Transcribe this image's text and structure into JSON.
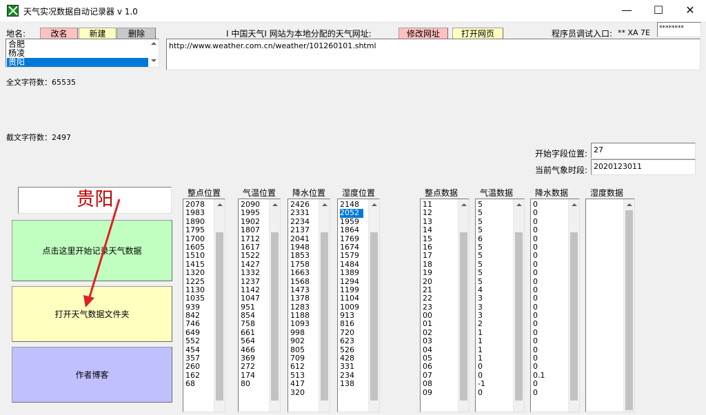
{
  "window": {
    "title": "天气实况数据自动记录器 v 1.0",
    "minimize": "—",
    "maximize": "☐",
    "close": "✕"
  },
  "toolbar": {
    "place_label": "地名:",
    "rename_btn": "改名",
    "new_btn": "新建",
    "delete_btn": "删除",
    "url_caption": "I 中国天气I 网站为本地分配的天气网址:",
    "edit_url_btn": "修改网址",
    "open_page_btn": "打开网页",
    "debug_label": "程序员调试入口:",
    "debug_code": "** XA 7E",
    "debug_value": "********"
  },
  "cities": [
    "合肥",
    "杨凌",
    "贵阳"
  ],
  "selected_city_index": 2,
  "url_value": "http://www.weather.com.cn/weather/101260101.shtml",
  "stats": {
    "full_chars": "全文字符数：65535",
    "cut_chars": "截文字符数：2497"
  },
  "fields": {
    "start_pos_label": "开始字段位置:",
    "start_pos_value": "27",
    "current_period_label": "当前气象时段:",
    "current_period_value": "2020123011"
  },
  "city_display": "贵阳",
  "buttons": {
    "start_record": "点击这里开始记录天气数据",
    "open_folder": "打开天气数据文件夹",
    "author_blog": "作者博客"
  },
  "colors": {
    "rename": "#ffc0c0",
    "new": "#ffffc0",
    "delete": "#c8c8c8",
    "edit_url": "#ffc0c0",
    "open_page": "#ffffc0",
    "start_btn": "#c0ffc0",
    "folder_btn": "#ffffc0",
    "blog_btn": "#c0c0ff",
    "city_text": "#c00000",
    "arrow": "#e02020"
  },
  "columns": [
    {
      "header": "整点位置",
      "values": [
        "2078",
        "1983",
        "1890",
        "1795",
        "1700",
        "1605",
        "1510",
        "1415",
        "1320",
        "1225",
        "1130",
        "1035",
        "939",
        "842",
        "746",
        "649",
        "552",
        "454",
        "357",
        "260",
        "162",
        "68"
      ],
      "selected": -1
    },
    {
      "header": "气温位置",
      "values": [
        "2090",
        "1995",
        "1902",
        "1807",
        "1712",
        "1617",
        "1522",
        "1427",
        "1332",
        "1237",
        "1142",
        "1047",
        "951",
        "854",
        "758",
        "661",
        "564",
        "466",
        "369",
        "272",
        "174",
        "80"
      ],
      "selected": -1
    },
    {
      "header": "降水位置",
      "values": [
        "2426",
        "2331",
        "2234",
        "2137",
        "2041",
        "1948",
        "1853",
        "1758",
        "1663",
        "1568",
        "1473",
        "1378",
        "1283",
        "1188",
        "1093",
        "998",
        "902",
        "805",
        "709",
        "612",
        "513",
        "417",
        "320"
      ],
      "selected": -1
    },
    {
      "header": "湿度位置",
      "values": [
        "2148",
        "2052",
        "1959",
        "1864",
        "1769",
        "1674",
        "1579",
        "1484",
        "1389",
        "1294",
        "1199",
        "1104",
        "1009",
        "913",
        "816",
        "720",
        "623",
        "526",
        "428",
        "331",
        "234",
        "138"
      ],
      "selected": 1
    },
    {
      "header": "整点数据",
      "values": [
        "11",
        "12",
        "13",
        "14",
        "15",
        "16",
        "17",
        "18",
        "19",
        "20",
        "21",
        "22",
        "23",
        "00",
        "01",
        "02",
        "03",
        "04",
        "05",
        "06",
        "07",
        "08",
        "09"
      ],
      "selected": -1
    },
    {
      "header": "气温数据",
      "values": [
        "5",
        "5",
        "5",
        "5",
        "6",
        "5",
        "5",
        "5",
        "5",
        "5",
        "4",
        "3",
        "3",
        "3",
        "2",
        "1",
        "1",
        "1",
        "1",
        "0",
        "0",
        "-1",
        "0"
      ],
      "selected": -1
    },
    {
      "header": "降水数据",
      "values": [
        "0",
        "0",
        "0",
        "0",
        "0",
        "0",
        "0",
        "0",
        "0",
        "0",
        "0",
        "0",
        "0",
        "0",
        "0",
        "0",
        "0",
        "0",
        "0",
        "0",
        "0.1",
        "0",
        "0"
      ],
      "selected": -1
    },
    {
      "header": "湿度数据",
      "values": [],
      "selected": -1
    }
  ]
}
